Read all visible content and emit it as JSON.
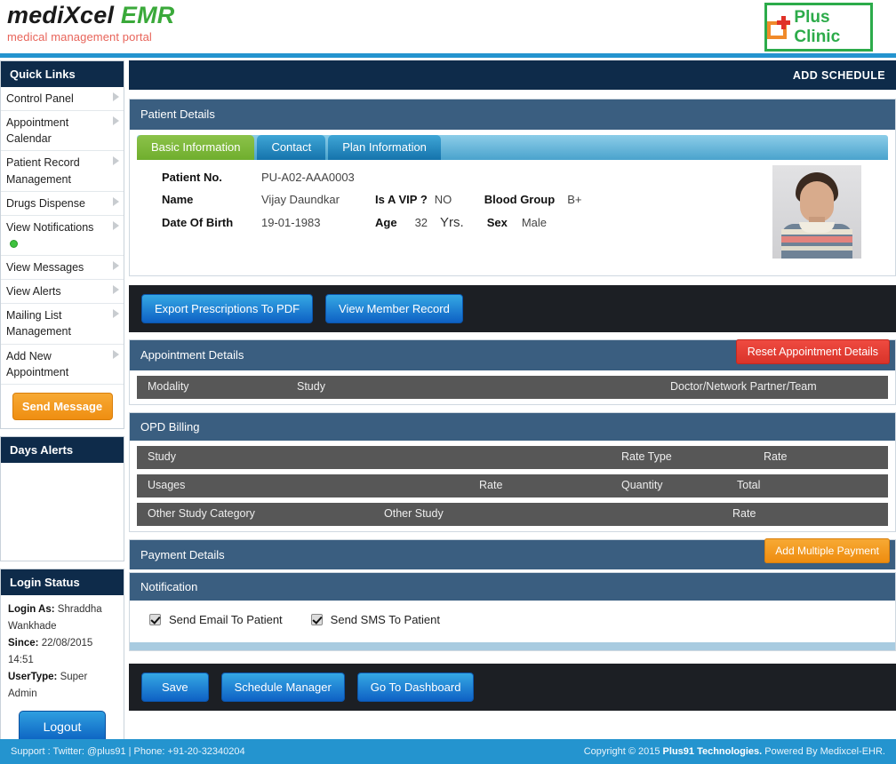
{
  "brand": {
    "logo_primary": "mediXcel",
    "logo_accent": "EMR",
    "tagline": "medical management portal",
    "clinic_name": "Plus Clinic"
  },
  "sidebar": {
    "quick_links_title": "Quick Links",
    "items": [
      {
        "label": "Control Panel",
        "badge": false
      },
      {
        "label": "Appointment Calendar",
        "badge": false
      },
      {
        "label": "Patient Record Management",
        "badge": false
      },
      {
        "label": "Drugs Dispense",
        "badge": false
      },
      {
        "label": "View Notifications",
        "badge": true
      },
      {
        "label": "View Messages",
        "badge": false
      },
      {
        "label": "View Alerts",
        "badge": false
      },
      {
        "label": "Mailing List Management",
        "badge": false
      },
      {
        "label": "Add New Appointment",
        "badge": false
      }
    ],
    "send_message_label": "Send Message",
    "days_alerts_title": "Days Alerts",
    "login_status_title": "Login Status",
    "login_as_label": "Login As:",
    "login_as_value": "Shraddha Wankhade",
    "since_label": "Since:",
    "since_value": "22/08/2015 14:51",
    "usertype_label": "UserType:",
    "usertype_value": "Super Admin",
    "logout_label": "Logout"
  },
  "header": {
    "page_title": "ADD SCHEDULE"
  },
  "patient_details": {
    "section_title": "Patient Details",
    "tabs": [
      {
        "label": "Basic Information",
        "active": true
      },
      {
        "label": "Contact",
        "active": false
      },
      {
        "label": "Plan Information",
        "active": false
      }
    ],
    "fields": {
      "patient_no_label": "Patient No.",
      "patient_no_value": "PU-A02-AAA0003",
      "name_label": "Name",
      "name_value": "Vijay Daundkar",
      "vip_label": "Is A VIP ?",
      "vip_value": "NO",
      "blood_group_label": "Blood Group",
      "blood_group_value": "B+",
      "dob_label": "Date Of Birth",
      "dob_value": "19-01-1983",
      "age_label": "Age",
      "age_value": "32",
      "age_unit": "Yrs.",
      "sex_label": "Sex",
      "sex_value": "Male"
    }
  },
  "actions": {
    "export_pdf_label": "Export Prescriptions To PDF",
    "view_member_record_label": "View Member Record"
  },
  "appointment_details": {
    "section_title": "Appointment Details",
    "reset_label": "Reset Appointment Details",
    "row": {
      "modality": "Modality",
      "study": "Study",
      "doctor": "Doctor/Network Partner/Team"
    }
  },
  "opd_billing": {
    "section_title": "OPD Billing",
    "row_study": {
      "c1": "Study",
      "c2": "Rate Type",
      "c3": "Rate"
    },
    "row_usages": {
      "c1": "Usages",
      "c2": "Rate",
      "c3": "Quantity",
      "c4": "Total"
    },
    "row_other": {
      "c1": "Other Study Category",
      "c2": "Other Study",
      "c3": "Rate"
    }
  },
  "payment_details": {
    "section_title": "Payment Details",
    "add_multiple_payment_label": "Add Multiple Payment"
  },
  "notification": {
    "section_title": "Notification",
    "send_email_label": "Send Email To Patient",
    "send_email_checked": true,
    "send_sms_label": "Send SMS To Patient",
    "send_sms_checked": true
  },
  "bottom_actions": {
    "save_label": "Save",
    "schedule_manager_label": "Schedule Manager",
    "go_to_dashboard_label": "Go To Dashboard"
  },
  "footer": {
    "support_text": "Support : Twitter: @plus91 | Phone: +91-20-32340204",
    "copyright_prefix": "Copyright © 2015 ",
    "copyright_company": "Plus91 Technologies.",
    "copyright_suffix": " Powered By Medixcel-EHR."
  },
  "colors": {
    "dark_navy": "#0e2b4a",
    "section_blue": "#3a5e80",
    "row_gray": "#575757",
    "accent_blue": "#2494cf",
    "orange": "#ef8e11",
    "red": "#d9342a",
    "green": "#6fae2e"
  }
}
